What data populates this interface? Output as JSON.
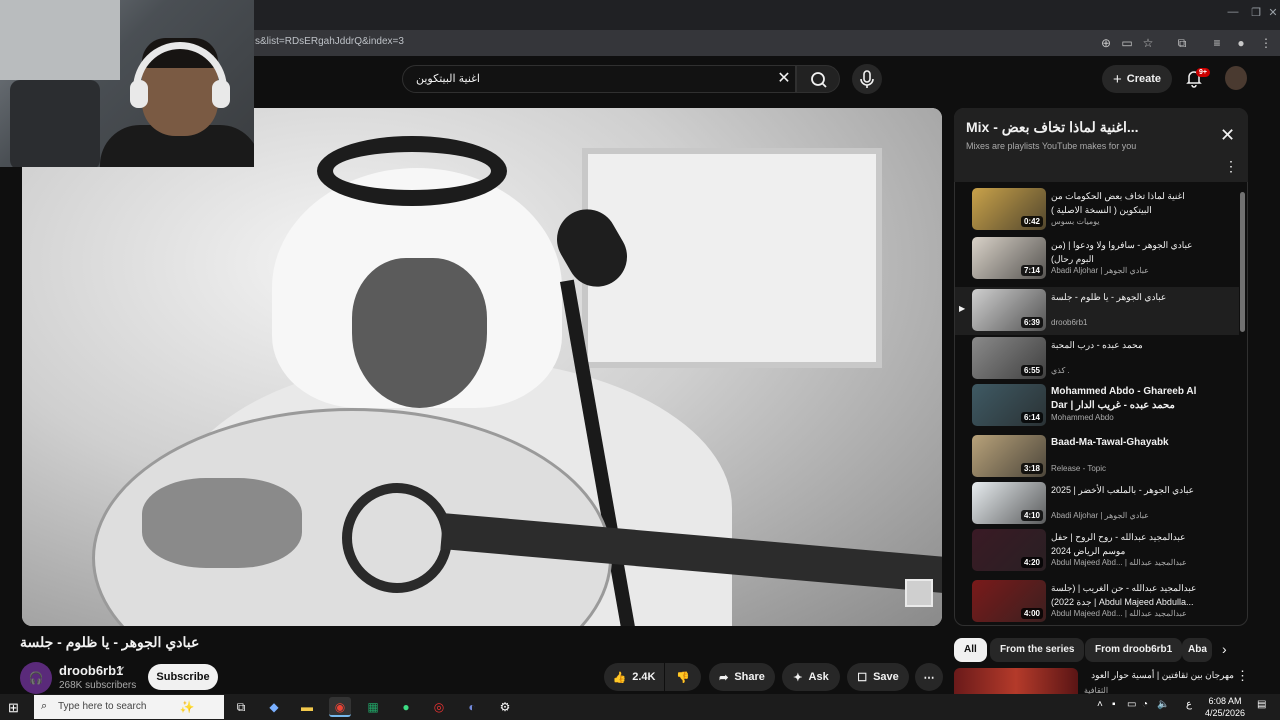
{
  "browser": {
    "url": "s&list=RDsERgahJddrQ&index=3",
    "window_controls": [
      "—",
      "❐",
      "✕"
    ]
  },
  "header": {
    "search_value": "اغنية البيتكوين",
    "create_label": "Create",
    "notif_count": "9+"
  },
  "video": {
    "title": "عبادي الجوهر - يا ظلوم - جلسة",
    "channel": "droob6rb1",
    "subscribers": "268K subscribers",
    "subscribe_label": "Subscribe",
    "likes": "2.4K",
    "share_label": "Share",
    "ask_label": "Ask",
    "save_label": "Save"
  },
  "playlist": {
    "title": "Mix - اغنية لماذا تخاف بعض...",
    "subtitle": "Mixes are playlists YouTube makes for you",
    "items": [
      {
        "title": "اغنية لماذا تخاف بعض الحكومات من البيتكوين ( النسخة الاصلية )",
        "channel": "يوميات بسوس",
        "duration": "0:42",
        "thumb": "#c9a24a"
      },
      {
        "title": "عبادي الجوهر - سافروا ولا ودعوا | (من البوم رحال)",
        "channel": "Abadi Aljohar | عبادي الجوهر",
        "duration": "7:14",
        "thumb": "#d9d2c8"
      },
      {
        "title": "عبادي الجوهر - يا ظلوم - جلسة",
        "channel": "droob6rb1",
        "duration": "6:39",
        "thumb": "#cfcfcf"
      },
      {
        "title": "محمد عبده - درب المحبة",
        "channel": "كذي .",
        "duration": "6:55",
        "thumb": "#8a8a8a"
      },
      {
        "title": "Mohammed Abdo - Ghareeb Al Dar | محمد عبده - غريب الدار",
        "channel": "Mohammed Abdo",
        "duration": "6:14",
        "thumb": "#3f5a64"
      },
      {
        "title": "Baad-Ma-Tawal-Ghayabk",
        "channel": "Release - Topic",
        "duration": "3:18",
        "thumb": "#b8a27a"
      },
      {
        "title": "عبادي الجوهر - بالملعب الأخضر | 2025",
        "channel": "Abadi Aljohar | عبادي الجوهر",
        "duration": "4:10",
        "thumb": "#e7ecef"
      },
      {
        "title": "عبدالمجيد عبدالله - روح الروح | حفل موسم الرياض 2024",
        "channel": "Abdul Majeed Abd... | عبدالمجيد عبدالله",
        "duration": "4:20",
        "thumb": "#3a1a25"
      },
      {
        "title": "عبدالمجيد عبدالله - حن الغريب | (جلسة جدة 2022) | Abdul Majeed Abdulla...",
        "channel": "Abdul Majeed Abd... | عبدالمجيد عبدالله",
        "duration": "4:00",
        "thumb": "#7a1a1a"
      }
    ]
  },
  "chips": [
    "All",
    "From the series",
    "From droob6rb1",
    "Aba"
  ],
  "recommendation": {
    "title": "مهرجان بين ثقافتين | أمسية حوار العود",
    "channel": "الثقافية"
  },
  "taskbar": {
    "search_placeholder": "Type here to search",
    "time": "6:08 AM",
    "date": "4/25/2026",
    "lang": "ع"
  },
  "colors": {
    "background": "#0f0f0f",
    "accent_red": "#cc0000",
    "chip_selected": "#f1f1f1"
  }
}
